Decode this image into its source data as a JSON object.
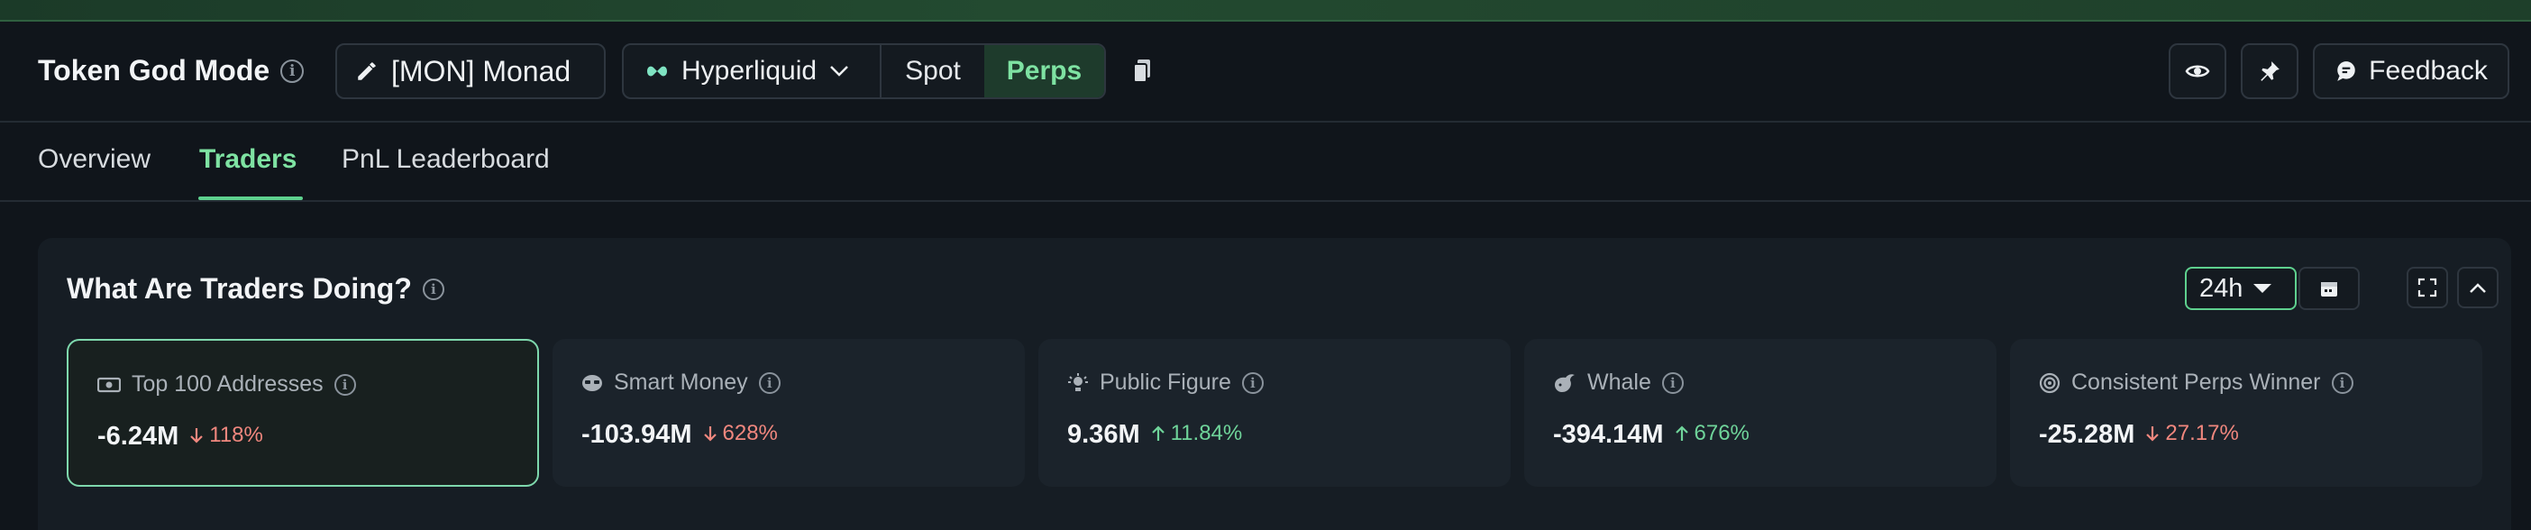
{
  "header": {
    "title": "Token God Mode",
    "token": "[MON] Monad",
    "exchange": "Hyperliquid",
    "segments": {
      "spot": "Spot",
      "perps": "Perps",
      "active": "Perps"
    },
    "feedback": "Feedback"
  },
  "tabs": [
    {
      "label": "Overview"
    },
    {
      "label": "Traders",
      "active": true
    },
    {
      "label": "PnL Leaderboard"
    }
  ],
  "panel": {
    "title": "What Are Traders Doing?",
    "range": "24h",
    "cards": [
      {
        "label": "Top 100 Addresses",
        "value": "-6.24M",
        "change": "118%",
        "direction": "down",
        "icon": "cash-icon",
        "selected": true
      },
      {
        "label": "Smart Money",
        "value": "-103.94M",
        "change": "628%",
        "direction": "down",
        "icon": "brain-icon"
      },
      {
        "label": "Public Figure",
        "value": "9.36M",
        "change": "11.84%",
        "direction": "up",
        "icon": "spotlight-icon"
      },
      {
        "label": "Whale",
        "value": "-394.14M",
        "change": "676%",
        "direction": "up",
        "icon": "whale-icon"
      },
      {
        "label": "Consistent Perps Winner",
        "value": "-25.28M",
        "change": "27.17%",
        "direction": "down",
        "icon": "target-icon"
      }
    ]
  },
  "colors": {
    "accent": "#7ee2a2",
    "down": "#f0877e",
    "up": "#6fd49a",
    "background": "#10151b"
  }
}
